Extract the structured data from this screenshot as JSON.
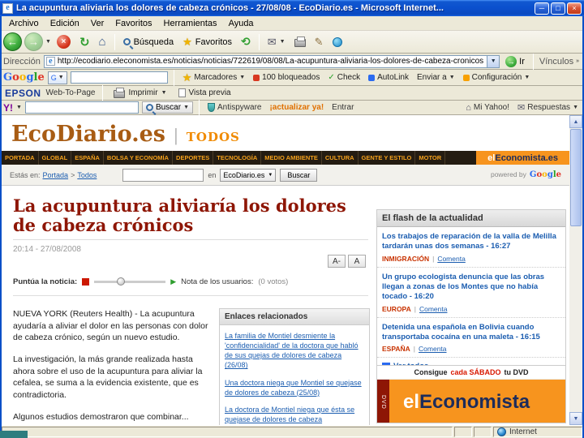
{
  "colors": {
    "titlebar_blue": "#0b50ce",
    "toolbar_beige": "#ece9d8",
    "brand_orange": "#f7941e",
    "headline_red": "#8e1605",
    "link_blue": "#1b5db0",
    "tag_red": "#c83200",
    "nav_dark": "#241c12"
  },
  "window": {
    "title": "La acupuntura aliviaria los dolores de cabeza crónicos - 27/08/08 - EcoDiario.es - Microsoft Internet...",
    "status": "Internet"
  },
  "menu": {
    "items": [
      "Archivo",
      "Edición",
      "Ver",
      "Favoritos",
      "Herramientas",
      "Ayuda"
    ]
  },
  "toolbar": {
    "search": "Búsqueda",
    "favorites": "Favoritos"
  },
  "address": {
    "label": "Dirección",
    "url": "http://ecodiario.eleconomista.es/noticias/noticias/722619/08/08/La-acupuntura-aliviaria-los-dolores-de-cabeza-cronicos.html",
    "go": "Ir",
    "links": "Vínculos"
  },
  "google": {
    "letters": [
      "G",
      "o",
      "o",
      "g",
      "l",
      "e"
    ],
    "buttons": [
      "Marcadores",
      "100 bloqueados",
      "Check",
      "AutoLink",
      "Enviar a",
      "Configuración"
    ]
  },
  "epson": {
    "brand": "EPSON",
    "product": "Web-To-Page",
    "print": "Imprimir",
    "preview": "Vista previa"
  },
  "yahoo": {
    "logo": "Y!",
    "search": "Buscar",
    "items_left": [
      "Antispyware",
      "¡actualizar ya!",
      "Entrar"
    ],
    "items_right": [
      "Mi Yahoo!",
      "Respuestas"
    ]
  },
  "masthead": {
    "logo": "EcoDiario.es",
    "divider": "|",
    "section": "TODOS"
  },
  "nav": {
    "tabs": [
      "PORTADA",
      "GLOBAL",
      "ESPAÑA",
      "BOLSA Y ECONOMÍA",
      "DEPORTES",
      "TECNOLOGÍA",
      "MEDIO AMBIENTE",
      "CULTURA",
      "GENTE Y ESTILO",
      "MOTOR"
    ],
    "brand_el": "el",
    "brand_rest": "Economista.es"
  },
  "subbar": {
    "breadcrumb_prefix": "Estás en:",
    "breadcrumb_home": "Portada",
    "breadcrumb_sep": ">",
    "breadcrumb_current": "Todos",
    "in_label": "en",
    "scope": "EcoDiario.es",
    "search": "Buscar",
    "powered_prefix": "powered by"
  },
  "article": {
    "title": "La acupuntura aliviaría los dolores de cabeza crónicos",
    "date": "20:14 - 27/08/2008",
    "font_smaller": "A-",
    "font_larger": "A",
    "rate_label": "Puntúa la noticia:",
    "score_label": "Nota de los usuarios:",
    "votes": "(0 votos)",
    "paragraphs": [
      "NUEVA YORK (Reuters Health) - La acupuntura ayudaría a aliviar el dolor en las personas con dolor de cabeza crónico, según un nuevo estudio.",
      "La investigación, la más grande realizada hasta ahora sobre el uso de la acupuntura para aliviar la cefalea, se suma a la evidencia existente, que es contradictoria.",
      "Algunos estudios demostraron que combinar..."
    ]
  },
  "related": {
    "title": "Enlaces relacionados",
    "links": [
      "La familia de Montiel desmiente la 'confidencialidad' de la doctora que habló de sus quejas de dolores de cabeza (26/08)",
      "Una doctora niega que Montiel se quejase de dolores de cabeza (25/08)",
      "La doctora de Montiel niega que ésta se quejase de dolores de cabeza"
    ]
  },
  "flash": {
    "title": "El flash de la actualidad",
    "items": [
      {
        "headline": "Los trabajos de reparación de la valla de Melilla tardarán unas dos semanas - 16:27",
        "tag": "INMIGRACIÓN",
        "sep": "|",
        "action": "Comenta"
      },
      {
        "headline": "Un grupo ecologista denuncia que las obras llegan a zonas de los Montes que no había tocado - 16:20",
        "tag": "EUROPA",
        "sep": "|",
        "action": "Comenta"
      },
      {
        "headline": "Detenida una española en Bolivia cuando transportaba cocaína en una maleta - 16:15",
        "tag": "ESPAÑA",
        "sep": "|",
        "action": "Comenta"
      }
    ],
    "see_all": "Ver todos"
  },
  "ad": {
    "top_pre": "Consigue",
    "top_highlight": "cada SÁBADO",
    "top_post": "tu DVD",
    "side": "DVD",
    "brand_el": "el",
    "brand_rest": "Economista"
  }
}
